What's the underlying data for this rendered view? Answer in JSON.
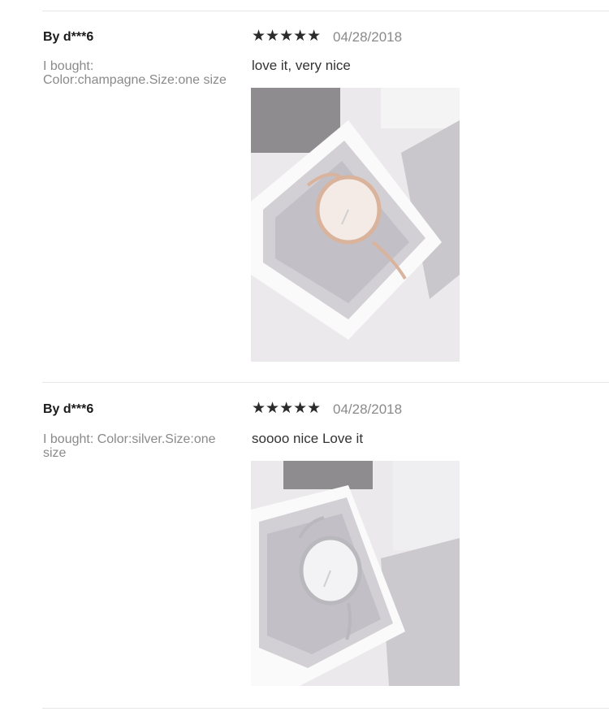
{
  "reviews": [
    {
      "author": "By d***6",
      "bought": "I bought: Color:champagne.Size:one size",
      "stars": "★★★★★",
      "date": "04/28/2018",
      "comment": "love it, very nice",
      "photo": {
        "alt": "rose gold watch in gift box",
        "watch_color": "#d9b39c",
        "face_color": "#f4ebe6"
      }
    },
    {
      "author": "By d***6",
      "bought": "I bought: Color:silver.Size:one size",
      "stars": "★★★★★",
      "date": "04/28/2018",
      "comment": "soooo nice Love it",
      "photo": {
        "alt": "silver watch in gift box",
        "watch_color": "#b9b9bd",
        "face_color": "#f3f3f5"
      }
    }
  ]
}
